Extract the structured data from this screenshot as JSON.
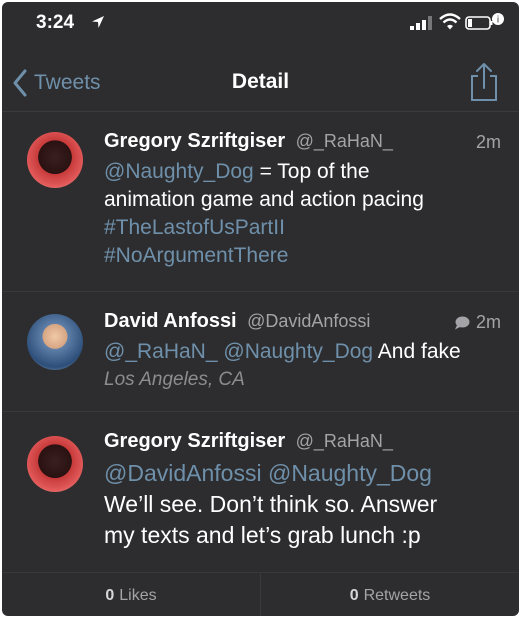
{
  "status_bar": {
    "time": "3:24"
  },
  "nav": {
    "back_label": "Tweets",
    "title": "Detail"
  },
  "tweets": [
    {
      "name": "Gregory Szriftgiser",
      "handle": "@_RaHaN_",
      "age": "2m",
      "lines": [
        {
          "link": "@Naughty_Dog",
          "rest": " = Top of the"
        },
        {
          "plain": "animation game and action pacing"
        },
        {
          "plain": "#TheLastofUsPartII"
        },
        {
          "plain": "#NoArgumentThere"
        }
      ]
    },
    {
      "name": "David Anfossi",
      "handle": "@DavidAnfossi",
      "age": "2m",
      "mention1": "@_RaHaN_",
      "mention2": "@Naughty_Dog",
      "rest": " And fake",
      "location": "Los Angeles, CA"
    },
    {
      "name": "Gregory Szriftgiser",
      "handle": "@_RaHaN_",
      "mention1": "@DavidAnfossi",
      "mention2": "@Naughty_Dog",
      "line2": "We’ll see. Don’t think so. Answer",
      "line3": "my texts and let’s grab lunch :p"
    }
  ],
  "actions": {
    "likes_count": "0",
    "likes_label": "Likes",
    "retweets_count": "0",
    "retweets_label": "Retweets"
  },
  "icons": {
    "back": "chevron-left-icon",
    "share": "share-icon",
    "reply": "speech-bubble-icon"
  },
  "colors": {
    "background": "#2d2d2f",
    "link": "#6f90aa",
    "muted": "#a3a3a8"
  }
}
